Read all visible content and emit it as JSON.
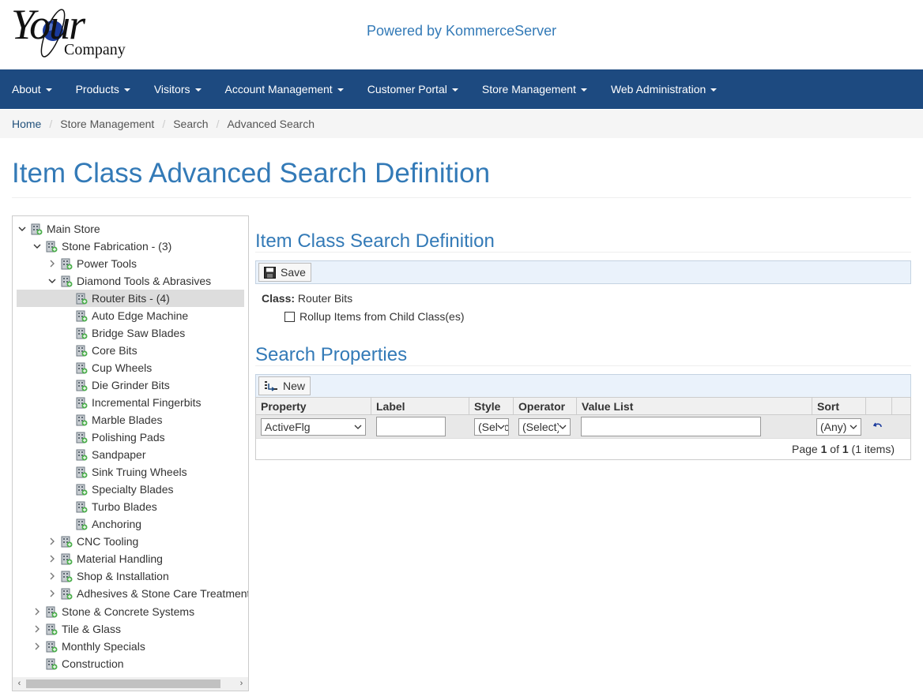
{
  "header": {
    "logo_main": "Your",
    "logo_sub": "Company",
    "powered_by": "Powered by KommerceServer"
  },
  "nav": {
    "items": [
      {
        "label": "About"
      },
      {
        "label": "Products"
      },
      {
        "label": "Visitors"
      },
      {
        "label": "Account Management"
      },
      {
        "label": "Customer Portal"
      },
      {
        "label": "Store Management"
      },
      {
        "label": "Web Administration"
      }
    ]
  },
  "breadcrumb": [
    "Home",
    "Store Management",
    "Search",
    "Advanced Search"
  ],
  "page_title": "Item Class Advanced Search Definition",
  "tree": {
    "items": [
      {
        "label": "Main Store"
      },
      {
        "label": "Stone Fabrication - (3)"
      },
      {
        "label": "Power Tools"
      },
      {
        "label": "Diamond Tools & Abrasives"
      },
      {
        "label": "Router Bits - (4)"
      },
      {
        "label": "Auto Edge Machine"
      },
      {
        "label": "Bridge Saw Blades"
      },
      {
        "label": "Core Bits"
      },
      {
        "label": "Cup Wheels"
      },
      {
        "label": "Die Grinder Bits"
      },
      {
        "label": "Incremental Fingerbits"
      },
      {
        "label": "Marble Blades"
      },
      {
        "label": "Polishing Pads"
      },
      {
        "label": "Sandpaper"
      },
      {
        "label": "Sink Truing Wheels"
      },
      {
        "label": "Specialty Blades"
      },
      {
        "label": "Turbo Blades"
      },
      {
        "label": "Anchoring"
      },
      {
        "label": "CNC Tooling"
      },
      {
        "label": "Material Handling"
      },
      {
        "label": "Shop & Installation"
      },
      {
        "label": "Adhesives & Stone Care Treatments"
      },
      {
        "label": "Stone & Concrete Systems"
      },
      {
        "label": "Tile & Glass"
      },
      {
        "label": "Monthly Specials"
      },
      {
        "label": "Construction"
      }
    ]
  },
  "definition": {
    "title": "Item Class Search Definition",
    "save_label": "Save",
    "class_label": "Class:",
    "class_value": "Router Bits",
    "rollup_label": "Rollup Items from Child Class(es)"
  },
  "properties": {
    "title": "Search Properties",
    "new_label": "New",
    "columns": [
      "Property",
      "Label",
      "Style",
      "Operator",
      "Value List",
      "Sort"
    ],
    "row": {
      "property": "ActiveFlg",
      "label": "",
      "style": "(Select)",
      "operator": "(Select)",
      "value_list": "",
      "sort": "(Any)"
    },
    "pager": {
      "prefix": "Page",
      "page": "1",
      "of": "of",
      "total_pages": "1",
      "count": "(1 items)"
    }
  },
  "colors": {
    "brand": "#337ab7",
    "navbar": "#1d4a80"
  }
}
